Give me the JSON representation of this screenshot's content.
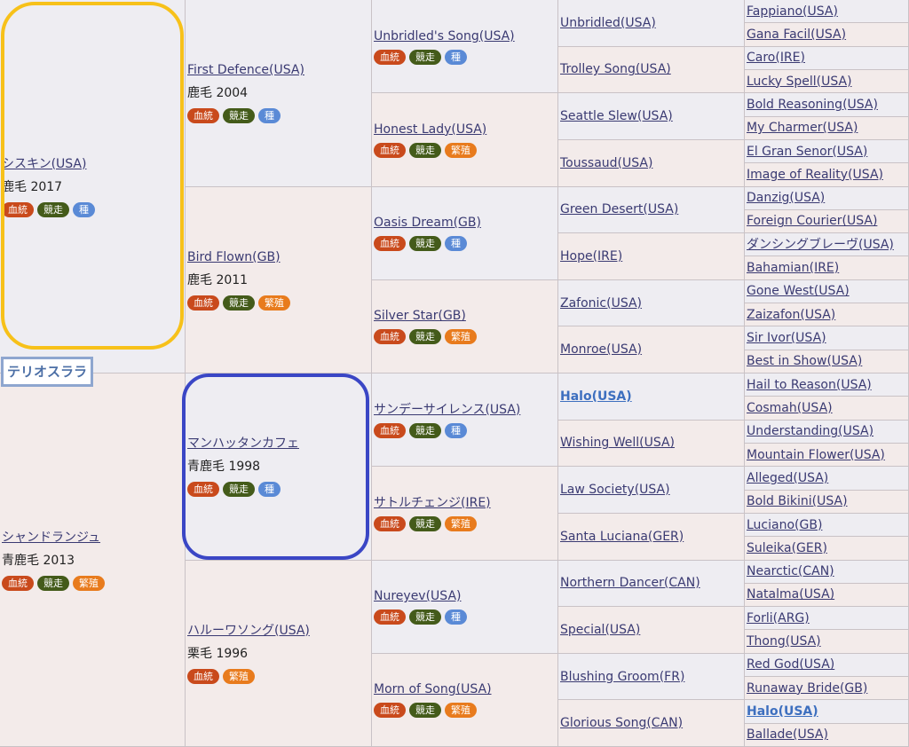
{
  "page": {
    "horse_label": "テリオスララ"
  },
  "badge_labels": {
    "blood": "血統",
    "race": "競走",
    "stud": "種",
    "breed": "繁殖"
  },
  "colors": {
    "blood": "#c94a1c",
    "race": "#445b1a",
    "stud": "#5a8ad6",
    "breed": "#e87b1d",
    "highlight_yellow": "#f7c11a",
    "highlight_blue": "#3a46c5"
  },
  "gen1": [
    {
      "name": "シスキン(USA)",
      "coat": "鹿毛 2017",
      "badges": [
        "blood",
        "race",
        "stud"
      ]
    },
    {
      "name": "シャンドランジュ",
      "coat": "青鹿毛 2013",
      "badges": [
        "blood",
        "race",
        "breed"
      ]
    }
  ],
  "gen2": [
    {
      "name": "First Defence(USA)",
      "coat": "鹿毛 2004",
      "badges": [
        "blood",
        "race",
        "stud"
      ]
    },
    {
      "name": "Bird Flown(GB)",
      "coat": "鹿毛 2011",
      "badges": [
        "blood",
        "race",
        "breed"
      ]
    },
    {
      "name": "マンハッタンカフェ",
      "coat": "青鹿毛 1998",
      "badges": [
        "blood",
        "race",
        "stud"
      ]
    },
    {
      "name": "ハルーワソング(USA)",
      "coat": "栗毛 1996",
      "badges": [
        "blood",
        "breed"
      ]
    }
  ],
  "gen3": [
    {
      "name": "Unbridled's Song(USA)",
      "badges": [
        "blood",
        "race",
        "stud"
      ]
    },
    {
      "name": "Honest Lady(USA)",
      "badges": [
        "blood",
        "race",
        "breed"
      ]
    },
    {
      "name": "Oasis Dream(GB)",
      "badges": [
        "blood",
        "race",
        "stud"
      ]
    },
    {
      "name": "Silver Star(GB)",
      "badges": [
        "blood",
        "race",
        "breed"
      ]
    },
    {
      "name": "サンデーサイレンス(USA)",
      "badges": [
        "blood",
        "race",
        "stud"
      ]
    },
    {
      "name": "サトルチェンジ(IRE)",
      "badges": [
        "blood",
        "race",
        "breed"
      ]
    },
    {
      "name": "Nureyev(USA)",
      "badges": [
        "blood",
        "race",
        "stud"
      ]
    },
    {
      "name": "Morn of Song(USA)",
      "badges": [
        "blood",
        "race",
        "breed"
      ]
    }
  ],
  "gen4": [
    {
      "name": "Unbridled(USA)"
    },
    {
      "name": "Trolley Song(USA)"
    },
    {
      "name": "Seattle Slew(USA)"
    },
    {
      "name": "Toussaud(USA)"
    },
    {
      "name": "Green Desert(USA)"
    },
    {
      "name": "Hope(IRE)"
    },
    {
      "name": "Zafonic(USA)"
    },
    {
      "name": "Monroe(USA)"
    },
    {
      "name": "Halo(USA)",
      "bold": true
    },
    {
      "name": "Wishing Well(USA)"
    },
    {
      "name": "Law Society(USA)"
    },
    {
      "name": "Santa Luciana(GER)"
    },
    {
      "name": "Northern Dancer(CAN)"
    },
    {
      "name": "Special(USA)"
    },
    {
      "name": "Blushing Groom(FR)"
    },
    {
      "name": "Glorious Song(CAN)"
    }
  ],
  "gen5": [
    {
      "name": "Fappiano(USA)"
    },
    {
      "name": "Gana Facil(USA)"
    },
    {
      "name": "Caro(IRE)"
    },
    {
      "name": "Lucky Spell(USA)"
    },
    {
      "name": "Bold Reasoning(USA)"
    },
    {
      "name": "My Charmer(USA)"
    },
    {
      "name": "El Gran Senor(USA)"
    },
    {
      "name": "Image of Reality(USA)"
    },
    {
      "name": "Danzig(USA)"
    },
    {
      "name": "Foreign Courier(USA)"
    },
    {
      "name": "ダンシングブレーヴ(USA)"
    },
    {
      "name": "Bahamian(IRE)"
    },
    {
      "name": "Gone West(USA)"
    },
    {
      "name": "Zaizafon(USA)"
    },
    {
      "name": "Sir Ivor(USA)"
    },
    {
      "name": "Best in Show(USA)"
    },
    {
      "name": "Hail to Reason(USA)"
    },
    {
      "name": "Cosmah(USA)"
    },
    {
      "name": "Understanding(USA)"
    },
    {
      "name": "Mountain Flower(USA)"
    },
    {
      "name": "Alleged(USA)"
    },
    {
      "name": "Bold Bikini(USA)"
    },
    {
      "name": "Luciano(GB)"
    },
    {
      "name": "Suleika(GER)"
    },
    {
      "name": "Nearctic(CAN)"
    },
    {
      "name": "Natalma(USA)"
    },
    {
      "name": "Forli(ARG)"
    },
    {
      "name": "Thong(USA)"
    },
    {
      "name": "Red God(USA)"
    },
    {
      "name": "Runaway Bride(GB)"
    },
    {
      "name": "Halo(USA)",
      "bold": true
    },
    {
      "name": "Ballade(USA)"
    }
  ]
}
